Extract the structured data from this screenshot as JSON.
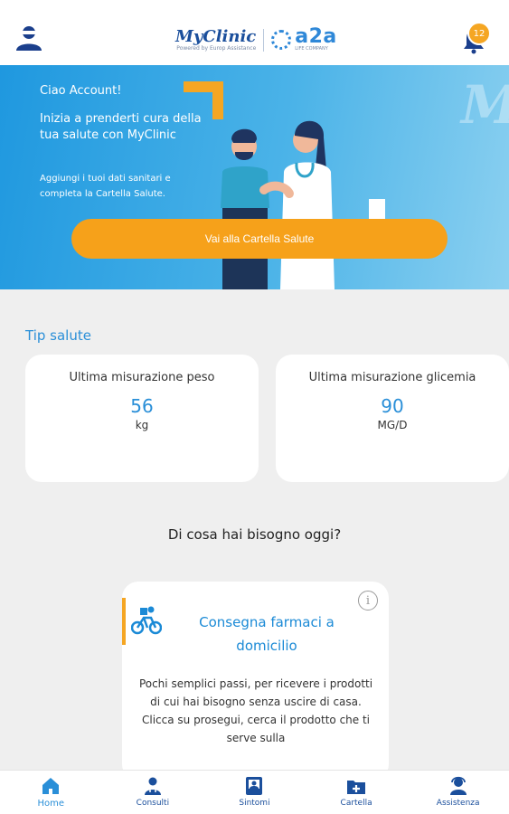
{
  "header": {
    "logo_myclinic": "MyClinic",
    "logo_myclinic_sub": "Powered by Europ Assistance",
    "logo_a2a": "a2a",
    "logo_a2a_sub": "LIFE COMPANY",
    "notification_count": "12"
  },
  "hero": {
    "watermark": "My",
    "greeting": "Ciao Account!",
    "title": "Inizia a prenderti cura della tua salute con MyClinic",
    "description": "Aggiungi i tuoi dati sanitari e completa la Cartella Salute.",
    "cta_label": "Vai alla Cartella Salute"
  },
  "tips": {
    "section_title": "Tip salute",
    "cards": [
      {
        "label": "Ultima misurazione peso",
        "value": "56",
        "unit": "kg"
      },
      {
        "label": "Ultima misurazione glicemia",
        "value": "90",
        "unit": "MG/D"
      }
    ]
  },
  "need": {
    "title": "Di cosa hai bisogno oggi?"
  },
  "service": {
    "title": "Consegna farmaci a domicilio",
    "description": "Pochi semplici passi, per ricevere i prodotti di cui hai bisogno senza uscire di casa. Clicca su prosegui, cerca il prodotto che ti serve sulla"
  },
  "bottom_nav": [
    {
      "label": "Home",
      "icon": "home-icon",
      "active": true
    },
    {
      "label": "Consulti",
      "icon": "doctor-icon"
    },
    {
      "label": "Sintomi",
      "icon": "symptoms-icon"
    },
    {
      "label": "Cartella",
      "icon": "folder-medical-icon"
    },
    {
      "label": "Assistenza",
      "icon": "support-icon"
    }
  ],
  "colors": {
    "primary_blue": "#2a8fd8",
    "navy": "#1b4f9c",
    "accent_orange": "#f6a11a"
  }
}
